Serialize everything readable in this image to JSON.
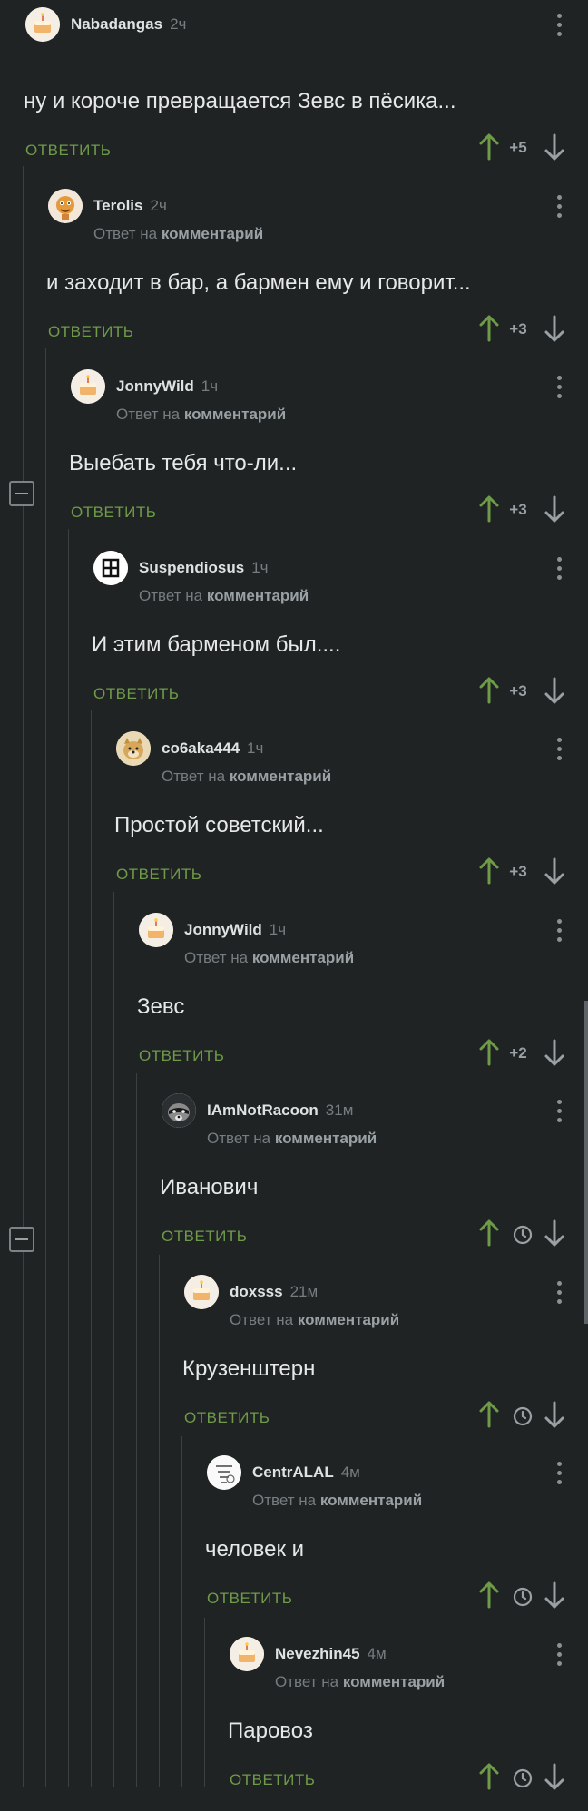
{
  "ui": {
    "reply_label": "ОТВЕТИТЬ",
    "reply_prefix": "Ответ на",
    "reply_target": "комментарий"
  },
  "colors": {
    "background": "#1f2324",
    "accent_green": "#6f9b48",
    "muted": "#767d80"
  },
  "comments": [
    {
      "author": "Nabadangas",
      "time": "2ч",
      "text": "ну и короче превращается Зевс в пёсика...",
      "score": "+5",
      "avatar": "cake-avatar-icon",
      "is_reply": false
    },
    {
      "author": "Terolis",
      "time": "2ч",
      "text": "и заходит в бар, а бармен ему и говорит...",
      "score": "+3",
      "avatar": "cartoon-avatar-icon",
      "is_reply": true
    },
    {
      "author": "JonnyWild",
      "time": "1ч",
      "text": "Выебать тебя что-ли...",
      "score": "+3",
      "avatar": "cake-avatar-icon",
      "is_reply": true
    },
    {
      "author": "Suspendiosus",
      "time": "1ч",
      "text": "И этим барменом был....",
      "score": "+3",
      "avatar": "logo-avatar-icon",
      "is_reply": true
    },
    {
      "author": "со6aka444",
      "time": "1ч",
      "text": "Простой советский...",
      "score": "+3",
      "avatar": "doge-avatar-icon",
      "is_reply": true
    },
    {
      "author": "JonnyWild",
      "time": "1ч",
      "text": "Зевс",
      "score": "+2",
      "avatar": "cake-avatar-icon",
      "is_reply": true
    },
    {
      "author": "IAmNotRacoon",
      "time": "31м",
      "text": "Иванович",
      "score": "",
      "avatar": "raccoon-avatar-icon",
      "is_reply": true
    },
    {
      "author": "doxsss",
      "time": "21м",
      "text": "Крузенштерн",
      "score": "",
      "avatar": "cake-avatar-icon",
      "is_reply": true
    },
    {
      "author": "CentrALAL",
      "time": "4м",
      "text": "человек и",
      "score": "",
      "avatar": "sketch-avatar-icon",
      "is_reply": true
    },
    {
      "author": "Nevezhin45",
      "time": "4м",
      "text": "Паровоз",
      "score": "",
      "avatar": "cake-avatar-icon",
      "is_reply": true
    }
  ]
}
